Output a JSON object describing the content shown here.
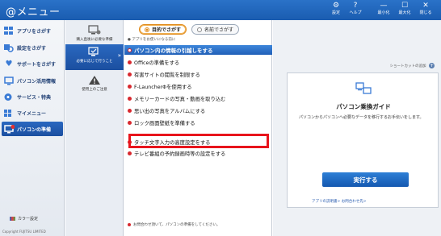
{
  "app": {
    "title": "@メニュー"
  },
  "titlebar": {
    "settings": "設定",
    "help": "ヘルプ",
    "minimize": "最小化",
    "maximize": "最大化",
    "close": "閉じる"
  },
  "sidebar": {
    "items": [
      {
        "label": "アプリをさがす",
        "icon": "apps-icon"
      },
      {
        "label": "設定をさがす",
        "icon": "settings-search-icon"
      },
      {
        "label": "サポートをさがす",
        "icon": "support-heart-icon"
      },
      {
        "label": "パソコン活用情報",
        "icon": "pc-info-icon"
      },
      {
        "label": "サービス・特典",
        "icon": "service-icon"
      },
      {
        "label": "マイメニュー",
        "icon": "mymenu-icon"
      },
      {
        "label": "パソコンの準備",
        "icon": "pc-setup-icon",
        "active": true
      }
    ],
    "color_setting": "カラー設定",
    "copyright": "Copyright FUJITSU LIMITED"
  },
  "categories": [
    {
      "label": "購入直後に必要な準備"
    },
    {
      "label": "必要に応じて行うこと",
      "active": true
    },
    {
      "label": "使用上のご注意"
    }
  ],
  "main": {
    "toggle": {
      "purpose": "目的でさがす",
      "name": "名前でさがす"
    },
    "hint": "アプリをお使いになる前に",
    "header": "パソコン内の情報の引越しをする",
    "items": [
      "Officeの準備をする",
      "有害サイトの閲覧を制限する",
      "F-LauncherΦを使用する",
      "メモリーカードの写真・動画を取り込む",
      "思い出の写真をアルバムにする",
      "ロック画面壁紙を準備する",
      "タッチ文字入力の高度設定をする",
      "テレビ番組の予約録画時等の設定をする"
    ],
    "footer": "お問合わせ頂いて、パソコンの準備をしてください。"
  },
  "right": {
    "shortcut": "ショートカットの追加",
    "card": {
      "title": "パソコン乗換ガイド",
      "desc": "パソコンからパソコンへ必要なデータを移行するお手伝いをします。",
      "run_button": "実行する",
      "links": "アプリの説明書>   お問合わせ先>"
    }
  },
  "colors": {
    "accent": "#1b5fb5",
    "highlight": "#e8141c",
    "bullet": "#d8282e"
  }
}
